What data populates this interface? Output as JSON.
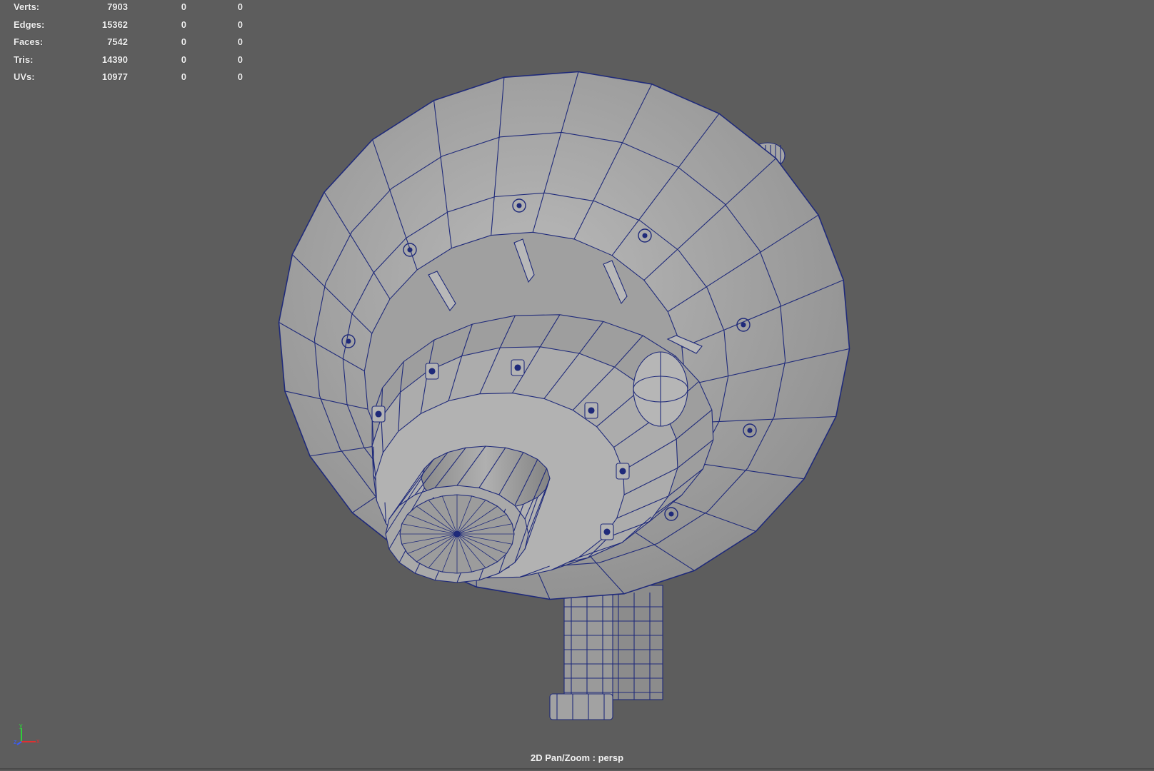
{
  "hud": {
    "rows": [
      {
        "label": "Verts:",
        "values": [
          "7903",
          "0",
          "0"
        ]
      },
      {
        "label": "Edges:",
        "values": [
          "15362",
          "0",
          "0"
        ]
      },
      {
        "label": "Faces:",
        "values": [
          "7542",
          "0",
          "0"
        ]
      },
      {
        "label": "Tris:",
        "values": [
          "14390",
          "0",
          "0"
        ]
      },
      {
        "label": "UVs:",
        "values": [
          "10977",
          "0",
          "0"
        ]
      }
    ]
  },
  "axis": {
    "y": "y",
    "z": "z",
    "x": "x"
  },
  "status": {
    "camera_label": "2D Pan/Zoom : persp"
  },
  "colors": {
    "background": "#5d5d5d",
    "mesh_fill": "#a8a8a8",
    "wireframe": "#1f2a7a"
  }
}
